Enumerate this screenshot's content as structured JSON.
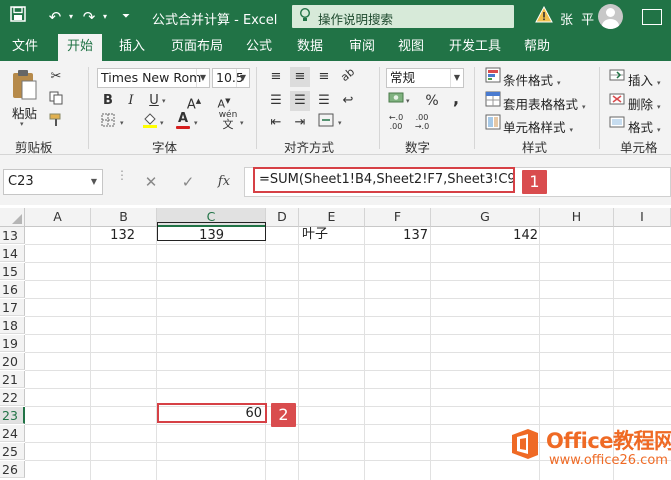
{
  "titlebar": {
    "title": "公式合并计算  -  Excel",
    "search_placeholder": "操作说明搜索",
    "user": "张 平"
  },
  "tabs": [
    "文件",
    "开始",
    "插入",
    "页面布局",
    "公式",
    "数据",
    "审阅",
    "视图",
    "开发工具",
    "帮助"
  ],
  "active_tab": "开始",
  "ribbon": {
    "clipboard": {
      "paste": "粘贴",
      "label": "剪贴板"
    },
    "font": {
      "name": "Times New Rom",
      "size": "10.5",
      "bold": "B",
      "italic": "I",
      "underline": "U",
      "font_color_glyph": "A",
      "wen": "wén",
      "label": "字体"
    },
    "alignment": {
      "label": "对齐方式"
    },
    "number": {
      "format": "常规",
      "percent": "%",
      "comma": ",",
      "label": "数字"
    },
    "styles": {
      "conditional": "条件格式",
      "table": "套用表格格式",
      "cell": "单元格样式",
      "label": "样式"
    },
    "cells": {
      "insert": "插入",
      "delete": "删除",
      "format": "格式",
      "label": "单元格"
    }
  },
  "formula_bar": {
    "name_box": "C23",
    "fx": "fx",
    "formula": "=SUM(Sheet1!B4,Sheet2!F7,Sheet3!C9)"
  },
  "callouts": [
    "1",
    "2"
  ],
  "grid": {
    "columns": [
      "A",
      "B",
      "C",
      "D",
      "E",
      "F",
      "G",
      "H",
      "I"
    ],
    "selected_column": "C",
    "rows": [
      "13",
      "14",
      "15",
      "16",
      "17",
      "18",
      "19",
      "20",
      "21",
      "22",
      "23",
      "24",
      "25",
      "26"
    ],
    "selected_row": "23",
    "row13": {
      "B": "132",
      "C": "139",
      "E": "叶子",
      "F": "137",
      "G": "142"
    },
    "row23": {
      "C": "60"
    }
  },
  "watermark": {
    "title": "Office教程网",
    "url": "www.office26.com"
  },
  "colors": {
    "excel_green": "#217346",
    "highlight_red": "#d64045",
    "watermark_orange": "#ef6a25"
  }
}
